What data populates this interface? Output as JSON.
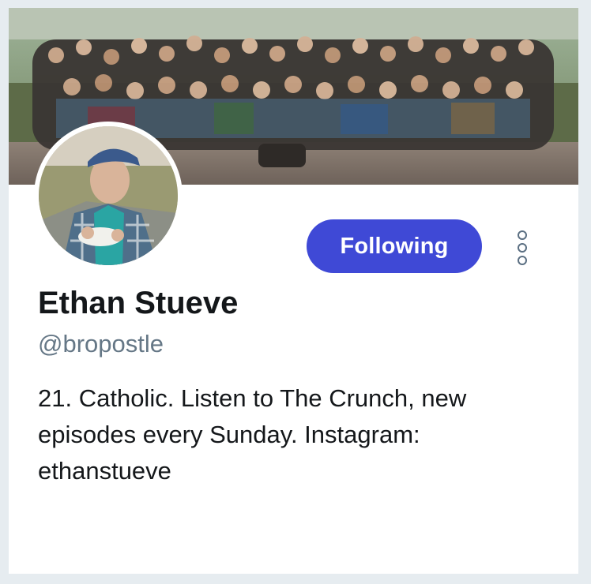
{
  "profile": {
    "display_name": "Ethan Stueve",
    "handle": "@bropostle",
    "bio": "21. Catholic. Listen to The Crunch, new episodes every Sunday. Instagram: ethanstueve"
  },
  "actions": {
    "follow_label": "Following",
    "more_icon": "more-vertical-icon"
  },
  "colors": {
    "accent": "#3f49d6",
    "name_text": "#14171a",
    "secondary_text": "#657786",
    "background": "#e6ecf0"
  }
}
